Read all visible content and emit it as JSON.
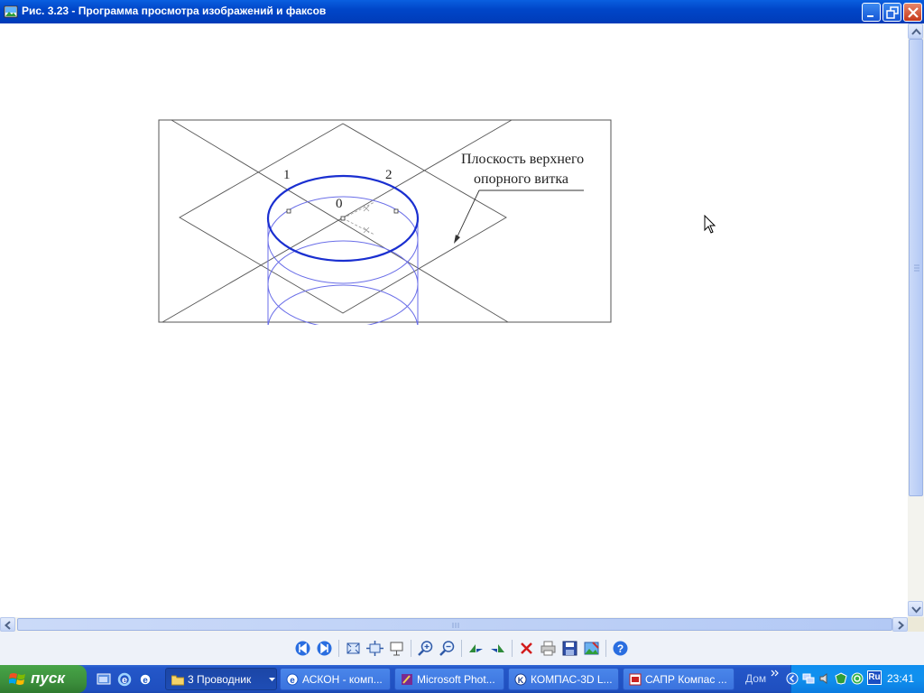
{
  "window": {
    "title": "Рис. 3.23 - Программа просмотра изображений и факсов"
  },
  "figure": {
    "label_1": "1",
    "label_2": "2",
    "label_0": "0",
    "callout_line1": "Плоскость верхнего",
    "callout_line2": "опорного витка",
    "coil_color": "#1a2fd0",
    "coil_faint_color": "#6a6ee8"
  },
  "toolbar": {
    "icons": [
      "prev-image-icon",
      "next-image-icon",
      "best-fit-icon",
      "actual-size-icon",
      "slideshow-icon",
      "zoom-in-icon",
      "zoom-out-icon",
      "rotate-clockwise-icon",
      "rotate-counterclockwise-icon",
      "delete-icon",
      "print-icon",
      "save-icon",
      "edit-icon",
      "help-icon"
    ]
  },
  "taskbar": {
    "start_label": "пуск",
    "tasks": [
      {
        "label": "3 Проводник",
        "icon": "folder-icon"
      },
      {
        "label": "АСКОН - комп...",
        "icon": "ie-icon"
      },
      {
        "label": "Microsoft Phot...",
        "icon": "photo-editor-icon"
      },
      {
        "label": "КОМПАС-3D L...",
        "icon": "kompas-icon"
      },
      {
        "label": "САПР Компас ...",
        "icon": "pdf-icon"
      }
    ],
    "toolbar_label": "Дом",
    "language": "Ru",
    "clock": "23:41"
  },
  "colors": {
    "titlebar": "#0046c8",
    "taskbar": "#2457c9",
    "start": "#3c8f3c",
    "tray": "#1190ee"
  }
}
